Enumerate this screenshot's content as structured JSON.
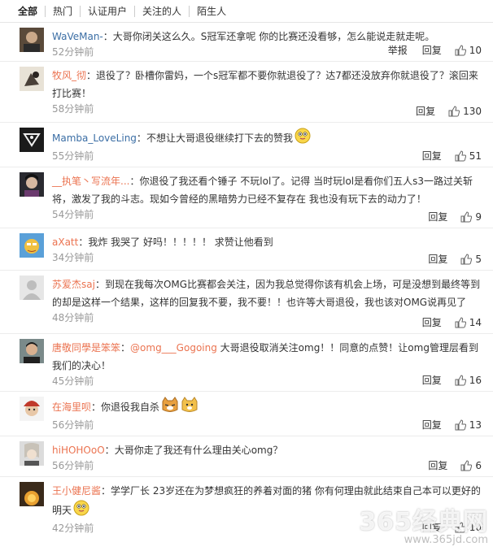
{
  "tabs": [
    "全部",
    "热门",
    "认证用户",
    "关注的人",
    "陌生人"
  ],
  "labels": {
    "report": "举报",
    "reply": "回复"
  },
  "comments": [
    {
      "user": "WaVeMan-",
      "sep": "：",
      "text": "大哥你闭关这么久。S冠军还拿呢 你的比赛还没看够，怎么能说走就走呢。",
      "time": "52分钟前",
      "likes": "10",
      "report": true
    },
    {
      "user": "牧风_彻",
      "sep": "：",
      "text": "退役了？卧槽你雷妈，一个s冠军都不要你就退役了？达7都还没放弃你就退役了？滚回来打比赛！",
      "time": "58分钟前",
      "likes": "130",
      "report": false
    },
    {
      "user": "Mamba_LoveLing",
      "sep": "：",
      "text": "不想让大哥退役继续打下去的赞我",
      "time": "55分钟前",
      "likes": "51",
      "report": false
    },
    {
      "user": "__执笔丶写流年...",
      "sep": "：",
      "text": "你退役了我还看个锤子 不玩lol了。记得 当时玩lol是看你们五人s3一路过关斩将，激发了我的斗志。现如今曾经的黑暗势力已经不复存在 我也没有玩下去的动力了！",
      "time": "54分钟前",
      "likes": "9",
      "report": false
    },
    {
      "user": "aXatt",
      "sep": "：",
      "text": "我炸 我哭了 好吗！！！！！ 求赞让他看到",
      "time": "34分钟前",
      "likes": "5",
      "report": false
    },
    {
      "user": "苏爱杰saj",
      "sep": "：",
      "text": "到现在我每次OMG比赛都会关注，因为我总觉得你该有机会上场，可是没想到最终等到的却是这样一个结果，这样的回复我不要，我不要！！也许等大哥退役，我也该对OMG说再见了",
      "time": "48分钟前",
      "likes": "14",
      "report": false
    },
    {
      "user": "唐敬同學是笨笨",
      "sep": "：",
      "mention": "@omg___Gogoing",
      "text": " 大哥退役取消关注omg！！同意的点赞！让omg管理层看到我们的决心！",
      "time": "45分钟前",
      "likes": "16",
      "report": false
    },
    {
      "user": "在海里呗",
      "sep": "：",
      "text": "你退役我自杀",
      "time": "56分钟前",
      "likes": "13",
      "report": false
    },
    {
      "user": "hiHOHOoO",
      "sep": "：",
      "text": "大哥你走了我还有什么理由关心omg？",
      "time": "56分钟前",
      "likes": "6",
      "report": false
    },
    {
      "user": "王小健尼酱",
      "sep": "：",
      "text": "学学厂长 23岁还在为梦想疯狂的养着对面的猪 你有何理由就此结束自己本可以更好的明天",
      "time": "42分钟前",
      "likes": "10",
      "report": false
    }
  ],
  "watermark": {
    "main": "365经典网",
    "sub": "www.365jd.com"
  }
}
